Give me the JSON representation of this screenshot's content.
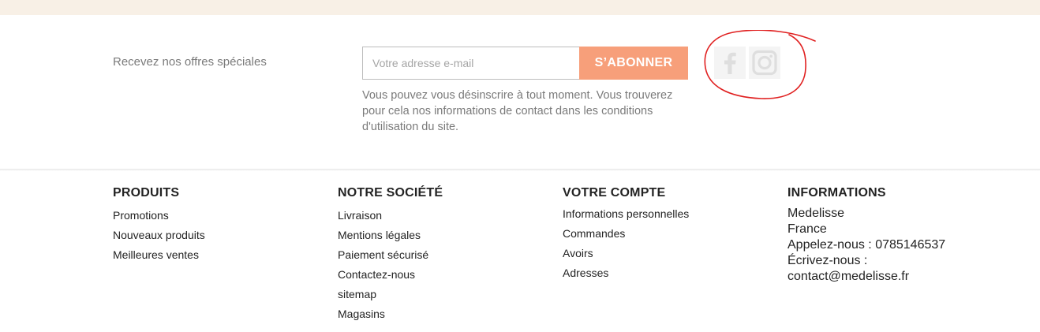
{
  "newsletter": {
    "label": "Recevez nos offres spéciales",
    "email_placeholder": "Votre adresse e-mail",
    "subscribe_button": "S’ABONNER",
    "note": "Vous pouvez vous désinscrire à tout moment. Vous trouverez pour cela nos informations de contact dans les conditions d'utilisation du site."
  },
  "social": [
    {
      "name": "facebook",
      "icon": "facebook-icon"
    },
    {
      "name": "instagram",
      "icon": "instagram-icon"
    }
  ],
  "footer": {
    "produits": {
      "title": "PRODUITS",
      "links": [
        "Promotions",
        "Nouveaux produits",
        "Meilleures ventes"
      ]
    },
    "societe": {
      "title": "NOTRE SOCIÉTÉ",
      "links": [
        "Livraison",
        "Mentions légales",
        "Paiement sécurisé",
        "Contactez-nous",
        "sitemap",
        "Magasins"
      ]
    },
    "compte": {
      "title": "VOTRE COMPTE",
      "links": [
        "Informations personnelles",
        "Commandes",
        "Avoirs",
        "Adresses"
      ]
    },
    "informations": {
      "title": "INFORMATIONS",
      "company": "Medelisse",
      "country": "France",
      "phone_label": "Appelez-nous :",
      "phone": "0785146537",
      "email_label": "Écrivez-nous :",
      "email": "contact@medelisse.fr"
    }
  },
  "colors": {
    "top_band": "#f8f0e6",
    "subscribe_button": "#f79f7a",
    "annotation": "#e02020"
  }
}
